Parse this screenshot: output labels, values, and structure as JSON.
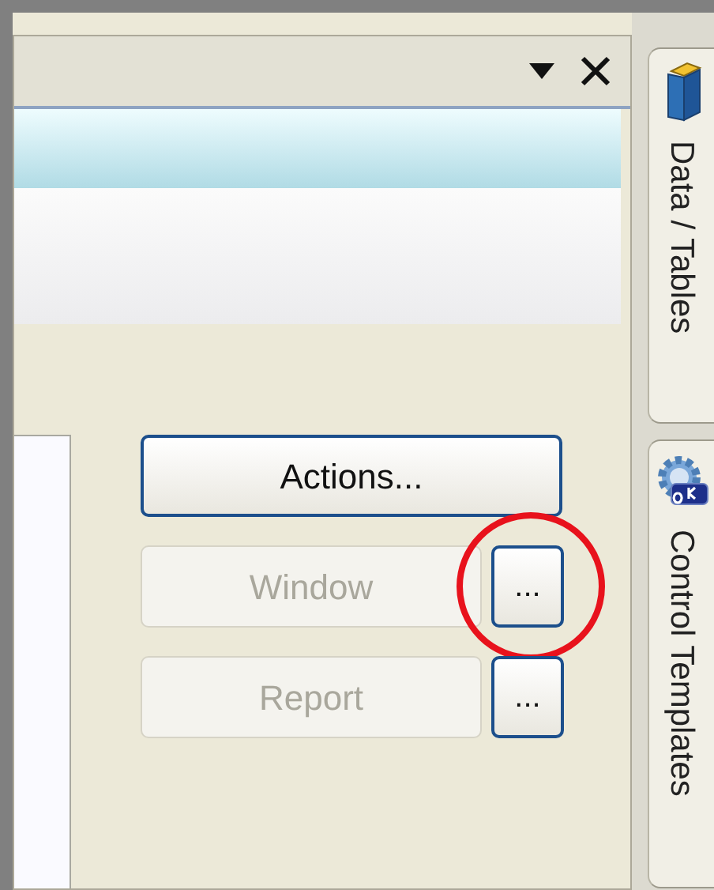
{
  "rows": [
    {
      "button": {
        "label": "Actions...",
        "disabled": false
      }
    },
    {
      "button": {
        "label": "Window",
        "disabled": true
      },
      "browse": {
        "label": "...",
        "circled": true
      }
    },
    {
      "button": {
        "label": "Report",
        "disabled": true
      },
      "browse": {
        "label": "...",
        "circled": false
      }
    }
  ],
  "side_tabs": [
    {
      "label": "Data / Tables"
    },
    {
      "label": "Control Templates"
    }
  ]
}
